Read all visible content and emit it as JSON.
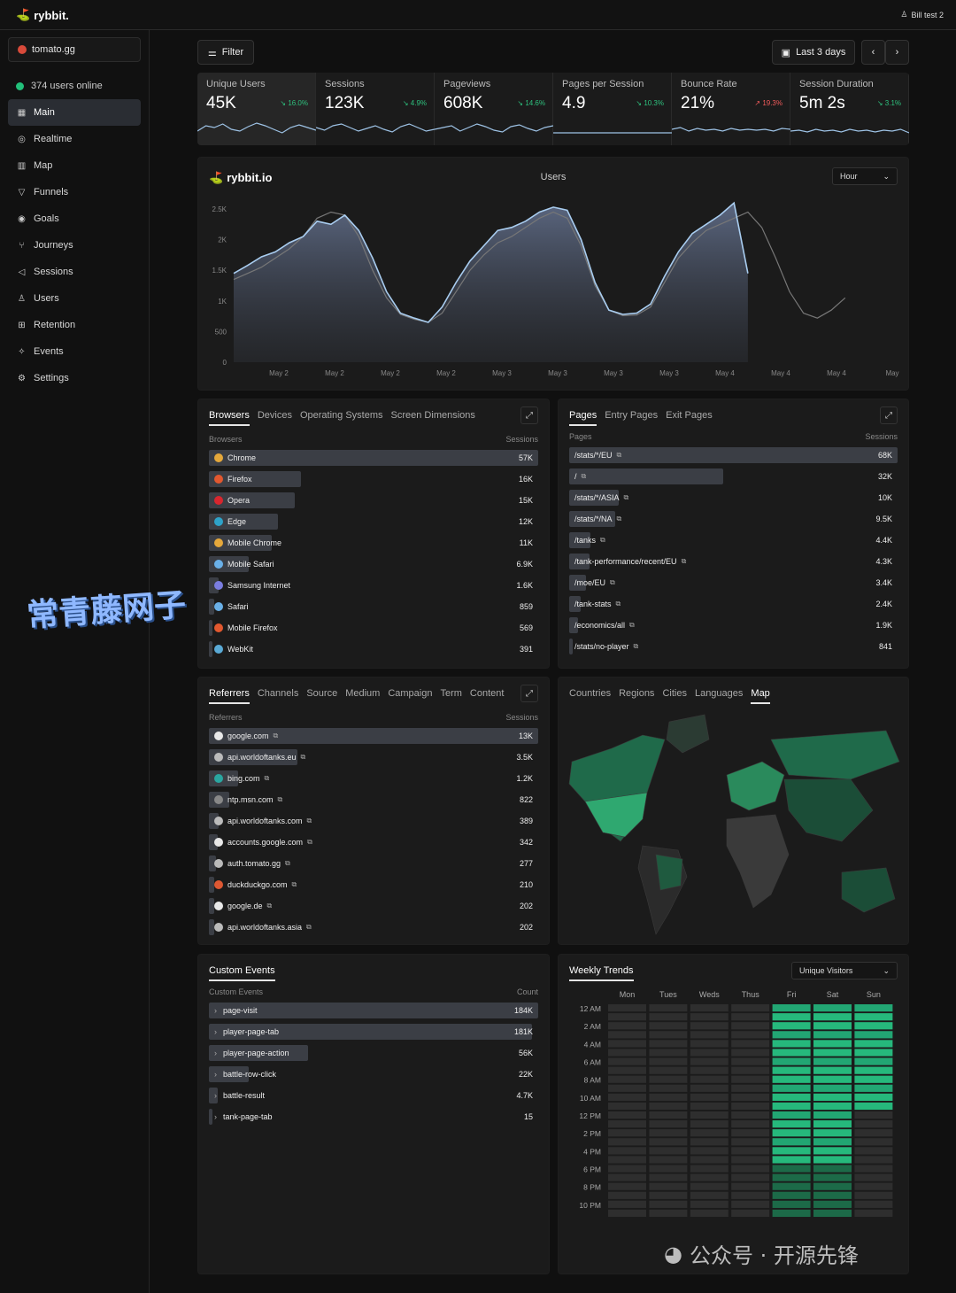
{
  "header": {
    "logo": "rybbit.",
    "user": "Bill test 2"
  },
  "sidebar": {
    "site": "tomato.gg",
    "online": "374 users online",
    "items": [
      {
        "label": "Main",
        "icon": "grid-icon",
        "glyph": "▦"
      },
      {
        "label": "Realtime",
        "icon": "globe-icon",
        "glyph": "◎"
      },
      {
        "label": "Map",
        "icon": "map-icon",
        "glyph": "▥"
      },
      {
        "label": "Funnels",
        "icon": "funnel-icon",
        "glyph": "▽"
      },
      {
        "label": "Goals",
        "icon": "target-icon",
        "glyph": "◉"
      },
      {
        "label": "Journeys",
        "icon": "journey-icon",
        "glyph": "⑂"
      },
      {
        "label": "Sessions",
        "icon": "rewind-icon",
        "glyph": "◁"
      },
      {
        "label": "Users",
        "icon": "user-icon",
        "glyph": "♙"
      },
      {
        "label": "Retention",
        "icon": "retention-icon",
        "glyph": "⊞"
      },
      {
        "label": "Events",
        "icon": "sparkle-icon",
        "glyph": "✧"
      },
      {
        "label": "Settings",
        "icon": "gear-icon",
        "glyph": "⚙"
      }
    ]
  },
  "toolbar": {
    "filter": "Filter",
    "range": "Last 3 days",
    "prev": "‹",
    "next": "›"
  },
  "stats": [
    {
      "label": "Unique Users",
      "value": "45K",
      "change": "16.0%",
      "dir": "down"
    },
    {
      "label": "Sessions",
      "value": "123K",
      "change": "4.9%",
      "dir": "down"
    },
    {
      "label": "Pageviews",
      "value": "608K",
      "change": "14.6%",
      "dir": "down"
    },
    {
      "label": "Pages per Session",
      "value": "4.9",
      "change": "10.3%",
      "dir": "down"
    },
    {
      "label": "Bounce Rate",
      "value": "21%",
      "change": "19.3%",
      "dir": "up"
    },
    {
      "label": "Session Duration",
      "value": "5m 2s",
      "change": "3.1%",
      "dir": "down"
    }
  ],
  "main_chart": {
    "brand": "rybbit.io",
    "title": "Users",
    "granularity": "Hour",
    "chart_data": {
      "type": "area",
      "title": "Users",
      "x_labels": [
        "May 2",
        "May 2",
        "May 2",
        "May 2",
        "May 3",
        "May 3",
        "May 3",
        "May 3",
        "May 4",
        "May 4",
        "May 4",
        "May"
      ],
      "ylim": [
        0,
        2500
      ],
      "yticks": [
        "0",
        "500",
        "1K",
        "1.5K",
        "2K",
        "2.5K"
      ],
      "series": [
        {
          "values": [
            1450,
            1580,
            1720,
            1800,
            1950,
            2050,
            2300,
            2250,
            2400,
            2150,
            1700,
            1150,
            800,
            720,
            650,
            900,
            1300,
            1650,
            1900,
            2150,
            2200,
            2300,
            2450,
            2530,
            2480,
            2000,
            1300,
            850,
            780,
            800,
            950,
            1400,
            1800,
            2100,
            2250,
            2400,
            2600,
            1450
          ]
        },
        {
          "values": [
            1350,
            1450,
            1550,
            1700,
            1850,
            2050,
            2350,
            2450,
            2400,
            2050,
            1500,
            1050,
            780,
            700,
            650,
            800,
            1150,
            1500,
            1750,
            1950,
            2050,
            2200,
            2350,
            2450,
            2350,
            1900,
            1250,
            850,
            760,
            770,
            900,
            1300,
            1700,
            1950,
            2150,
            2250,
            2350,
            2450,
            2200,
            1700,
            1150,
            800,
            720,
            850,
            1050
          ]
        }
      ]
    }
  },
  "browsers": {
    "tabs": [
      "Browsers",
      "Devices",
      "Operating Systems",
      "Screen Dimensions"
    ],
    "col1": "Browsers",
    "col2": "Sessions",
    "rows": [
      {
        "label": "Chrome",
        "value": "57K",
        "pct": 1.0,
        "color": "#e5a83b"
      },
      {
        "label": "Firefox",
        "value": "16K",
        "pct": 0.28,
        "color": "#e2582f"
      },
      {
        "label": "Opera",
        "value": "15K",
        "pct": 0.26,
        "color": "#d8262e"
      },
      {
        "label": "Edge",
        "value": "12K",
        "pct": 0.21,
        "color": "#2ea3c9"
      },
      {
        "label": "Mobile Chrome",
        "value": "11K",
        "pct": 0.19,
        "color": "#e5a83b"
      },
      {
        "label": "Mobile Safari",
        "value": "6.9K",
        "pct": 0.12,
        "color": "#6ab0e8"
      },
      {
        "label": "Samsung Internet",
        "value": "1.6K",
        "pct": 0.03,
        "color": "#7a7de0"
      },
      {
        "label": "Safari",
        "value": "859",
        "pct": 0.015,
        "color": "#6ab0e8"
      },
      {
        "label": "Mobile Firefox",
        "value": "569",
        "pct": 0.01,
        "color": "#e2582f"
      },
      {
        "label": "WebKit",
        "value": "391",
        "pct": 0.007,
        "color": "#5aaad6"
      }
    ]
  },
  "pages": {
    "tabs": [
      "Pages",
      "Entry Pages",
      "Exit Pages"
    ],
    "col1": "Pages",
    "col2": "Sessions",
    "rows": [
      {
        "label": "/stats/*/EU",
        "value": "68K",
        "pct": 1.0
      },
      {
        "label": "/",
        "value": "32K",
        "pct": 0.47
      },
      {
        "label": "/stats/*/ASIA",
        "value": "10K",
        "pct": 0.15
      },
      {
        "label": "/stats/*/NA",
        "value": "9.5K",
        "pct": 0.14
      },
      {
        "label": "/tanks",
        "value": "4.4K",
        "pct": 0.065
      },
      {
        "label": "/tank-performance/recent/EU",
        "value": "4.3K",
        "pct": 0.063
      },
      {
        "label": "/moe/EU",
        "value": "3.4K",
        "pct": 0.05
      },
      {
        "label": "/tank-stats",
        "value": "2.4K",
        "pct": 0.035
      },
      {
        "label": "/economics/all",
        "value": "1.9K",
        "pct": 0.028
      },
      {
        "label": "/stats/no-player",
        "value": "841",
        "pct": 0.012
      }
    ]
  },
  "referrers": {
    "tabs": [
      "Referrers",
      "Channels",
      "Source",
      "Medium",
      "Campaign",
      "Term",
      "Content"
    ],
    "col1": "Referrers",
    "col2": "Sessions",
    "rows": [
      {
        "label": "google.com",
        "value": "13K",
        "pct": 1.0,
        "color": "#e8e8e8"
      },
      {
        "label": "api.worldoftanks.eu",
        "value": "3.5K",
        "pct": 0.27,
        "color": "#bbbbbb"
      },
      {
        "label": "bing.com",
        "value": "1.2K",
        "pct": 0.09,
        "color": "#2aa6a0"
      },
      {
        "label": "ntp.msn.com",
        "value": "822",
        "pct": 0.063,
        "color": "#888888"
      },
      {
        "label": "api.worldoftanks.com",
        "value": "389",
        "pct": 0.03,
        "color": "#bbbbbb"
      },
      {
        "label": "accounts.google.com",
        "value": "342",
        "pct": 0.026,
        "color": "#e8e8e8"
      },
      {
        "label": "auth.tomato.gg",
        "value": "277",
        "pct": 0.021,
        "color": "#bbbbbb"
      },
      {
        "label": "duckduckgo.com",
        "value": "210",
        "pct": 0.016,
        "color": "#de5833"
      },
      {
        "label": "google.de",
        "value": "202",
        "pct": 0.015,
        "color": "#e8e8e8"
      },
      {
        "label": "api.worldoftanks.asia",
        "value": "202",
        "pct": 0.015,
        "color": "#bbbbbb"
      }
    ]
  },
  "geo": {
    "tabs": [
      "Countries",
      "Regions",
      "Cities",
      "Languages",
      "Map"
    ]
  },
  "events": {
    "title": "Custom Events",
    "col1": "Custom Events",
    "col2": "Count",
    "rows": [
      {
        "label": "page-visit",
        "value": "184K",
        "pct": 1.0
      },
      {
        "label": "player-page-tab",
        "value": "181K",
        "pct": 0.98
      },
      {
        "label": "player-page-action",
        "value": "56K",
        "pct": 0.3
      },
      {
        "label": "battle-row-click",
        "value": "22K",
        "pct": 0.12
      },
      {
        "label": "battle-result",
        "value": "4.7K",
        "pct": 0.026
      },
      {
        "label": "tank-page-tab",
        "value": "15",
        "pct": 0.0
      }
    ]
  },
  "weekly": {
    "title": "Weekly Trends",
    "metric": "Unique Visitors",
    "days": [
      "Mon",
      "Tues",
      "Weds",
      "Thus",
      "Fri",
      "Sat",
      "Sun"
    ],
    "hours": [
      "12 AM",
      "2 AM",
      "4 AM",
      "6 AM",
      "8 AM",
      "10 AM",
      "12 PM",
      "2 PM",
      "4 PM",
      "6 PM",
      "8 PM",
      "10 PM"
    ],
    "active_days": [
      0,
      0,
      0,
      0,
      1,
      1,
      1
    ],
    "sun_active_rows": 12
  },
  "watermarks": {
    "left": "常青藤网子",
    "right": "公众号 · 开源先锋"
  }
}
